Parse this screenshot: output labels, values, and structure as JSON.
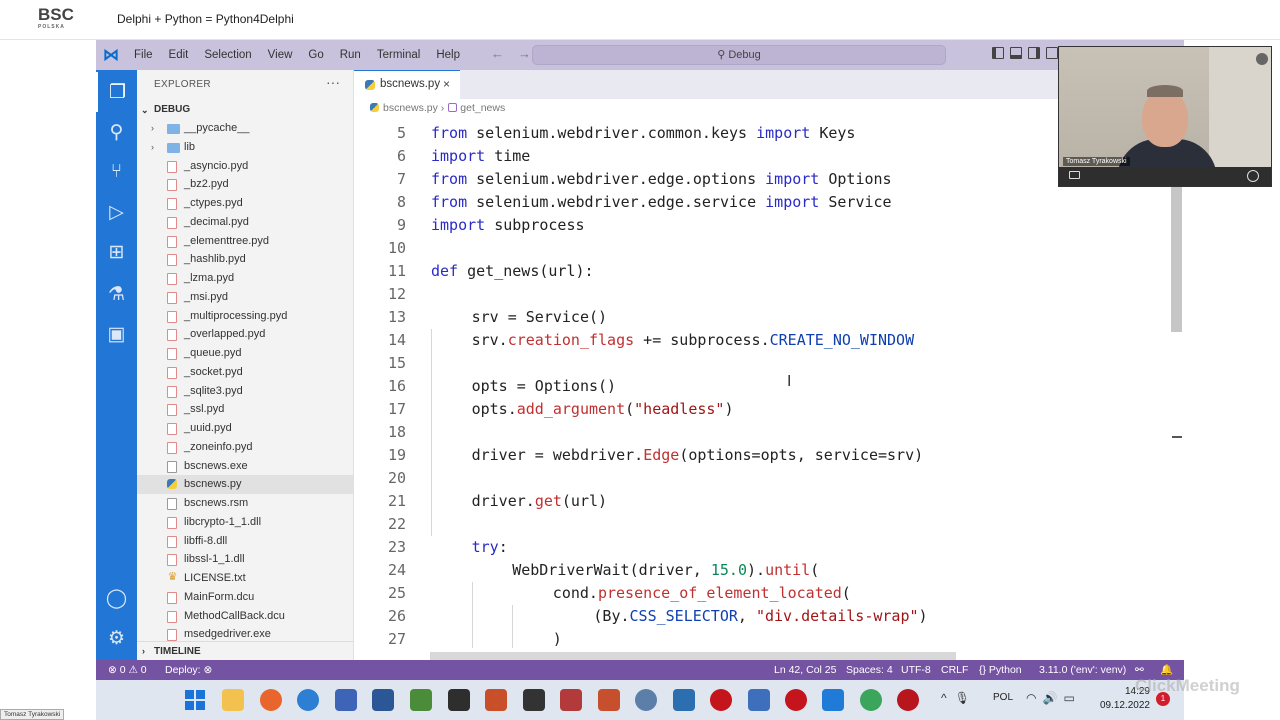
{
  "header": {
    "logo_text": "BSC",
    "logo_sub": "POLSKA",
    "title": "Delphi + Python = Python4Delphi"
  },
  "menu": [
    "File",
    "Edit",
    "Selection",
    "View",
    "Go",
    "Run",
    "Terminal",
    "Help"
  ],
  "command_center": {
    "label": "Debug",
    "icon": "search-icon"
  },
  "sidebar": {
    "title": "EXPLORER",
    "more": "···",
    "folder": "DEBUG",
    "timeline": "TIMELINE",
    "items": [
      {
        "label": "__pycache__",
        "type": "folder"
      },
      {
        "label": "lib",
        "type": "folder"
      },
      {
        "label": "_asyncio.pyd",
        "type": "pyd"
      },
      {
        "label": "_bz2.pyd",
        "type": "pyd"
      },
      {
        "label": "_ctypes.pyd",
        "type": "pyd"
      },
      {
        "label": "_decimal.pyd",
        "type": "pyd"
      },
      {
        "label": "_elementtree.pyd",
        "type": "pyd"
      },
      {
        "label": "_hashlib.pyd",
        "type": "pyd"
      },
      {
        "label": "_lzma.pyd",
        "type": "pyd"
      },
      {
        "label": "_msi.pyd",
        "type": "pyd"
      },
      {
        "label": "_multiprocessing.pyd",
        "type": "pyd"
      },
      {
        "label": "_overlapped.pyd",
        "type": "pyd"
      },
      {
        "label": "_queue.pyd",
        "type": "pyd"
      },
      {
        "label": "_socket.pyd",
        "type": "pyd"
      },
      {
        "label": "_sqlite3.pyd",
        "type": "pyd"
      },
      {
        "label": "_ssl.pyd",
        "type": "pyd"
      },
      {
        "label": "_uuid.pyd",
        "type": "pyd"
      },
      {
        "label": "_zoneinfo.pyd",
        "type": "pyd"
      },
      {
        "label": "bscnews.exe",
        "type": "exe"
      },
      {
        "label": "bscnews.py",
        "type": "py"
      },
      {
        "label": "bscnews.rsm",
        "type": "exe"
      },
      {
        "label": "libcrypto-1_1.dll",
        "type": "pyd"
      },
      {
        "label": "libffi-8.dll",
        "type": "pyd"
      },
      {
        "label": "libssl-1_1.dll",
        "type": "pyd"
      },
      {
        "label": "LICENSE.txt",
        "type": "lic"
      },
      {
        "label": "MainForm.dcu",
        "type": "pyd"
      },
      {
        "label": "MethodCallBack.dcu",
        "type": "pyd"
      },
      {
        "label": "msedgedriver.exe",
        "type": "pyd"
      }
    ]
  },
  "editor": {
    "tab_label": "bscnews.py",
    "tab_close": "×",
    "breadcrumb_file": "bscnews.py",
    "breadcrumb_sep": "›",
    "breadcrumb_symbol": "get_news"
  },
  "code_lines": [
    {
      "n": "5",
      "indent": 0,
      "html": "<span class=\"kw\">from</span> selenium.webdriver.common.keys <span class=\"kw\">import</span> Keys"
    },
    {
      "n": "6",
      "indent": 0,
      "html": "<span class=\"kw\">import</span> time"
    },
    {
      "n": "7",
      "indent": 0,
      "html": "<span class=\"kw\">from</span> selenium.webdriver.edge.options <span class=\"kw\">import</span> Options"
    },
    {
      "n": "8",
      "indent": 0,
      "html": "<span class=\"kw\">from</span> selenium.webdriver.edge.service <span class=\"kw\">import</span> Service"
    },
    {
      "n": "9",
      "indent": 0,
      "html": "<span class=\"kw\">import</span> subprocess"
    },
    {
      "n": "10",
      "indent": 0,
      "html": ""
    },
    {
      "n": "11",
      "indent": 0,
      "html": "<span class=\"kw\">def</span> get_news(url):"
    },
    {
      "n": "12",
      "indent": 0,
      "html": ""
    },
    {
      "n": "13",
      "indent": 1,
      "html": "srv = Service()"
    },
    {
      "n": "14",
      "indent": 1,
      "html": "srv.<span class=\"fn\">creation_flags</span> += subprocess.<span class=\"const\">CREATE_NO_WINDOW</span>"
    },
    {
      "n": "15",
      "indent": 0,
      "html": ""
    },
    {
      "n": "16",
      "indent": 1,
      "html": "opts = Options()"
    },
    {
      "n": "17",
      "indent": 1,
      "html": "opts.<span class=\"fn\">add_argument</span>(<span class=\"str\">\"headless\"</span>)"
    },
    {
      "n": "18",
      "indent": 0,
      "html": ""
    },
    {
      "n": "19",
      "indent": 1,
      "html": "driver = webdriver.<span class=\"fn\">Edge</span>(options=opts, service=srv)"
    },
    {
      "n": "20",
      "indent": 0,
      "html": ""
    },
    {
      "n": "21",
      "indent": 1,
      "html": "driver.<span class=\"fn\">get</span>(url)"
    },
    {
      "n": "22",
      "indent": 0,
      "html": ""
    },
    {
      "n": "23",
      "indent": 1,
      "html": "<span class=\"kw\">try</span>:"
    },
    {
      "n": "24",
      "indent": 2,
      "html": "WebDriverWait(driver, <span class=\"num\">15.0</span>).<span class=\"fn\">until</span>("
    },
    {
      "n": "25",
      "indent": 3,
      "html": "cond.<span class=\"fn\">presence_of_element_located</span>("
    },
    {
      "n": "26",
      "indent": 4,
      "html": "(By.<span class=\"const\">CSS_SELECTOR</span>, <span class=\"str\">\"div.details-wrap\"</span>)"
    },
    {
      "n": "27",
      "indent": 3,
      "html": ")"
    }
  ],
  "status": {
    "problems": "⊗ 0 ⚠ 0",
    "deploy": "Deploy: ⊗",
    "position": "Ln 42, Col 25",
    "spaces": "Spaces: 4",
    "encoding": "UTF-8",
    "eol": "CRLF",
    "language": "{} Python",
    "interpreter": "3.11.0 ('env': venv)"
  },
  "webcam": {
    "name": "Tomasz Tyrakowski"
  },
  "taskbar": {
    "lang": "POL",
    "time": "14:29",
    "date": "09.12.2022",
    "badge": "1"
  },
  "watermark": "ClickMeeting",
  "corner_label": "Tomasz Tyrakowski"
}
